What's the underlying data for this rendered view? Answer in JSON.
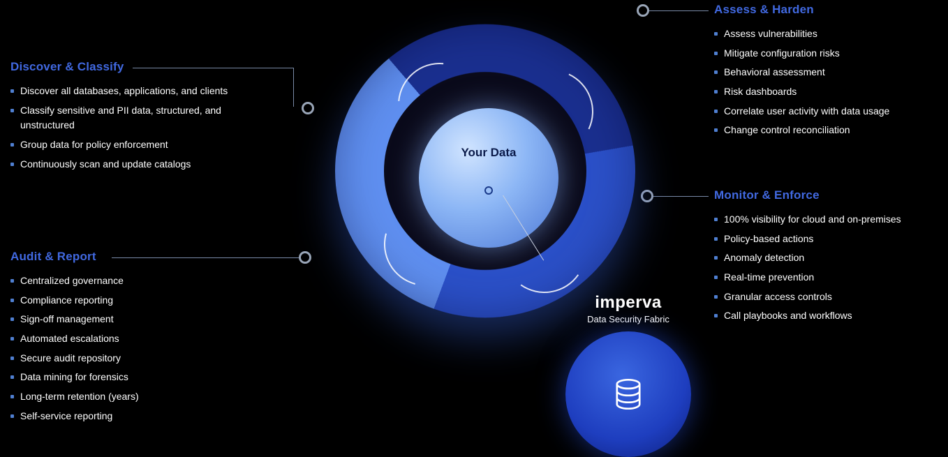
{
  "center": {
    "core_label": "Your Data",
    "brand": "imperva",
    "brand_sub": "Data Security Fabric"
  },
  "sections": {
    "discover": {
      "title": "Discover & Classify",
      "items": [
        "Discover all databases, applications, and clients",
        "Classify sensitive and PII data, structured, and unstructured",
        "Group data for policy enforcement",
        "Continuously scan and update catalogs"
      ]
    },
    "assess": {
      "title": "Assess & Harden",
      "items": [
        "Assess vulnerabilities",
        "Mitigate configuration risks",
        "Behavioral assessment",
        "Risk dashboards",
        "Correlate user activity with data usage",
        "Change control reconciliation"
      ]
    },
    "monitor": {
      "title": "Monitor & Enforce",
      "items": [
        "100% visibility for cloud and on-premises",
        "Policy-based actions",
        "Anomaly detection",
        "Real-time prevention",
        "Granular access controls",
        "Call playbooks and workflows"
      ]
    },
    "audit": {
      "title": "Audit & Report",
      "items": [
        "Centralized governance",
        "Compliance reporting",
        "Sign-off management",
        "Automated escalations",
        "Secure audit repository",
        "Data mining for forensics",
        "Long-term retention (years)",
        "Self-service reporting"
      ]
    }
  }
}
